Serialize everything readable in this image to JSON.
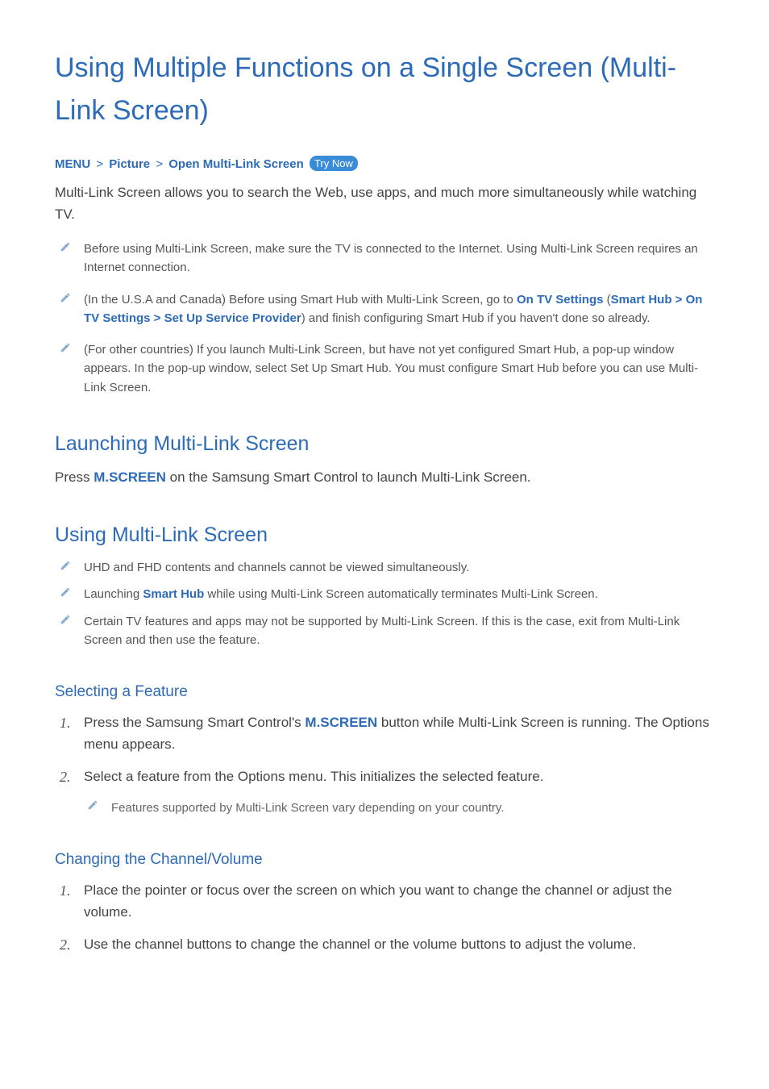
{
  "page_title": "Using Multiple Functions on a Single Screen (Multi-Link Screen)",
  "breadcrumb": {
    "menu": "MENU",
    "picture": "Picture",
    "open": "Open Multi-Link Screen",
    "try_now": "Try Now"
  },
  "intro": "Multi-Link Screen allows you to search the Web, use apps, and much more simultaneously while watching TV.",
  "notes_top": [
    {
      "text": "Before using Multi-Link Screen, make sure the TV is connected to the Internet. Using Multi-Link Screen requires an Internet connection."
    },
    {
      "prefix": "(In the U.S.A and Canada) Before using Smart Hub with Multi-Link Screen, go to ",
      "link1": "On TV Settings",
      "paren_open": " (",
      "link2": "Smart Hub",
      "sep1": " > ",
      "link3": "On TV Settings",
      "sep2": " > ",
      "link4": "Set Up Service Provider",
      "paren_close": ")",
      "suffix": " and finish configuring Smart Hub if you haven't done so already."
    },
    {
      "text": "(For other countries) If you launch Multi-Link Screen, but have not yet configured Smart Hub, a pop-up window appears. In the pop-up window, select Set Up Smart Hub. You must configure Smart Hub before you can use Multi-Link Screen."
    }
  ],
  "h2_launching": "Launching Multi-Link Screen",
  "launching": {
    "prefix": "Press ",
    "button": "M.SCREEN",
    "suffix": " on the Samsung Smart Control to launch Multi-Link Screen."
  },
  "h2_using": "Using Multi-Link Screen",
  "using_notes": [
    {
      "text": "UHD and FHD contents and channels cannot be viewed simultaneously."
    },
    {
      "prefix": "Launching ",
      "link": "Smart Hub",
      "suffix": " while using Multi-Link Screen automatically terminates Multi-Link Screen."
    },
    {
      "text": "Certain TV features and apps may not be supported by Multi-Link Screen. If this is the case, exit from Multi-Link Screen and then use the feature."
    }
  ],
  "h3_selecting": "Selecting a Feature",
  "selecting_steps": {
    "step1_prefix": "Press the Samsung Smart Control's ",
    "step1_button": "M.SCREEN",
    "step1_suffix": " button while Multi-Link Screen is running. The Options menu appears.",
    "step2": "Select a feature from the Options menu. This initializes the selected feature.",
    "step2_note": "Features supported by Multi-Link Screen vary depending on your country."
  },
  "h3_changing": "Changing the Channel/Volume",
  "changing_steps": {
    "step1": "Place the pointer or focus over the screen on which you want to change the channel or adjust the volume.",
    "step2": "Use the channel buttons to change the channel or the volume buttons to adjust the volume."
  }
}
